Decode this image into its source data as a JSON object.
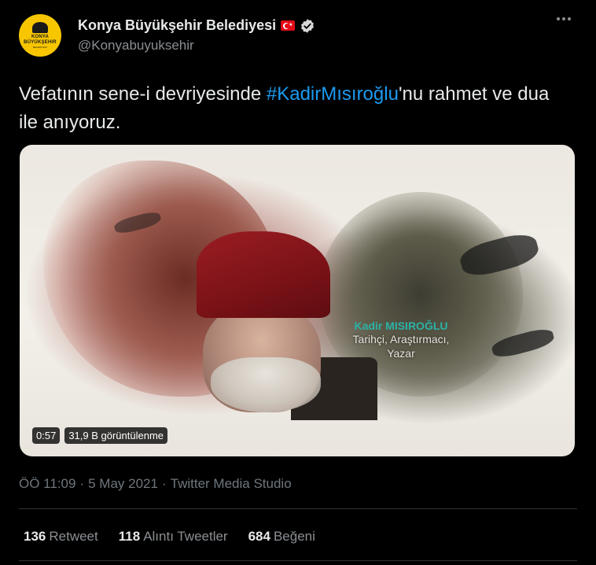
{
  "author": {
    "name": "Konya Büyükşehir Belediyesi",
    "handle": "@Konyabuyuksehir",
    "avatar_lines": [
      "KONYA",
      "BÜYÜKŞEHIR",
      "BELEDİYESİ"
    ]
  },
  "tweet": {
    "text_before": "Vefatının sene-i devriyesinde  ",
    "hashtag": "#KadirMısıroğlu",
    "text_after": "'nu rahmet ve dua ile anıyoruz."
  },
  "media": {
    "caption_name": "Kadir MISIROĞLU",
    "caption_line1": "Tarihçi, Araştırmacı,",
    "caption_line2": "Yazar",
    "duration": "0:57",
    "views": "31,9 B görüntülenme"
  },
  "meta": {
    "time": "ÖÖ 11:09",
    "sep1": "·",
    "date": "5 May 2021",
    "sep2": "·",
    "source": "Twitter Media Studio"
  },
  "stats": {
    "retweets": "136",
    "retweets_label": "Retweet",
    "quotes": "118",
    "quotes_label": "Alıntı Tweetler",
    "likes": "684",
    "likes_label": "Beğeni"
  },
  "colors": {
    "background": "#000000",
    "hashtag": "#1d9bf0",
    "avatar_bg": "#f7c600",
    "caption_accent": "#2bb3a6"
  }
}
